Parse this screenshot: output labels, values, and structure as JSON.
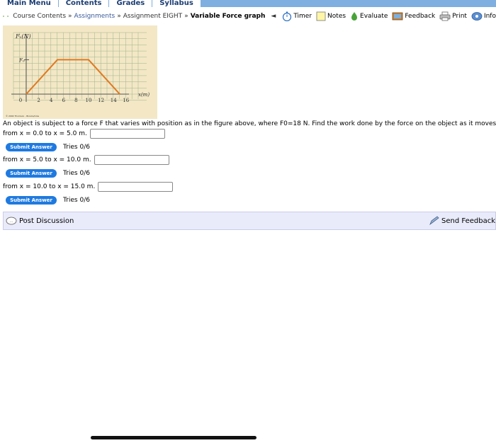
{
  "menu": [
    "Main Menu",
    "Contents",
    "Grades",
    "Syllabus"
  ],
  "breadcrumb": {
    "course_contents": "Course Contents",
    "sep": "»",
    "assignments": "Assignments",
    "assignment": "Assignment EIGHT",
    "current": "Variable Force graph",
    "back_marker": "◄"
  },
  "tools": {
    "timer": "Timer",
    "notes": "Notes",
    "evaluate": "Evaluate",
    "feedback": "Feedback",
    "print": "Print",
    "info": "Info"
  },
  "figure": {
    "y_label": "Fₓ(N)",
    "f_label": "F₀",
    "x_label": "x(m)",
    "ticks": [
      "0",
      "2",
      "4",
      "6",
      "8",
      "10",
      "12",
      "14",
      "16"
    ],
    "credit": "© 2004 Thomson - Brooks/Cole",
    "graph_points": [
      [
        0,
        0
      ],
      [
        5,
        18
      ],
      [
        10,
        18
      ],
      [
        15,
        0
      ]
    ],
    "line_color": "#e07a20"
  },
  "question": "An object is subject to a force F that varies with position as in the figure above, where F0=18 N. Find the work done by the force on the object as it moves:",
  "parts": [
    {
      "label": "from x = 0.0 to x = 5.0 m.",
      "value": "",
      "submit": "Submit Answer",
      "tries": "Tries 0/6"
    },
    {
      "label": "from x = 5.0 to x = 10.0 m.",
      "value": "",
      "submit": "Submit Answer",
      "tries": "Tries 0/6"
    },
    {
      "label": "from x = 10.0 to x = 15.0 m.",
      "value": "",
      "submit": "Submit Answer",
      "tries": "Tries 0/6"
    }
  ],
  "discussion": {
    "post": "Post Discussion",
    "send_feedback": "Send Feedback"
  }
}
